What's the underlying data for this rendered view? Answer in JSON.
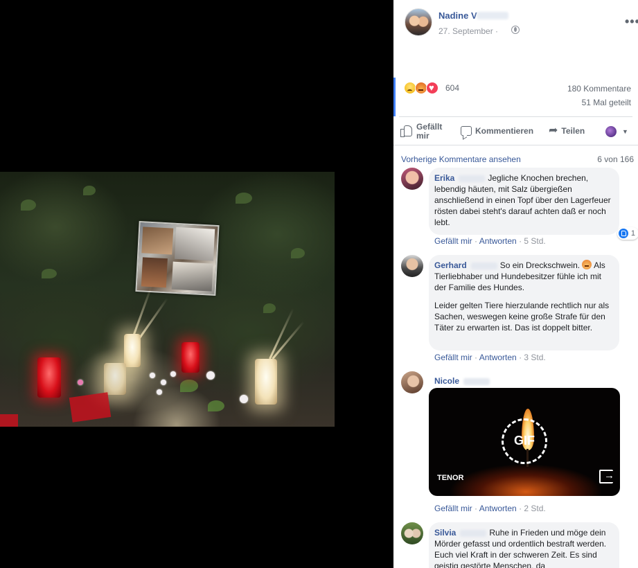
{
  "post": {
    "author": "Nadine V",
    "date": "27. September ·",
    "reaction_count": "604",
    "comments_count": "180 Kommentare",
    "shares_count": "51 Mal geteilt",
    "actions": {
      "like": "Gefällt mir",
      "comment": "Kommentieren",
      "share": "Teilen"
    },
    "icons": [
      "sad-reaction",
      "angry-reaction",
      "love-reaction",
      "globe-icon",
      "more-icon"
    ]
  },
  "comments_header": {
    "prev": "Vorherige Kommentare ansehen",
    "count": "6 von 166"
  },
  "meta_labels": {
    "like": "Gefällt mir",
    "reply": "Antworten",
    "sep": " · "
  },
  "comments": [
    {
      "name": "Erika",
      "text": "Jegliche Knochen brechen, lebendig häuten, mit Salz übergießen anschließend in einen Topf über den Lagerfeuer rösten dabei steht's darauf achten daß er noch lebt.",
      "time": "5 Std.",
      "likes": "1"
    },
    {
      "name": "Gerhard",
      "text": "So ein Dreckschwein.",
      "text2": "Als Tierliebhaber und Hundebesitzer fühle ich mit der Familie des Hundes.",
      "text3": "Leider gelten Tiere hierzulande rechtlich nur als Sachen, weswegen keine große Strafe für den Täter zu erwarten ist. Das ist doppelt bitter.",
      "time": "3 Std."
    },
    {
      "name": "Nicole",
      "gif_label": "GIF",
      "gif_provider": "TENOR",
      "time": "2 Std."
    },
    {
      "name": "Silvia",
      "text": "Ruhe in Frieden und möge dein Mörder gefasst und ordentlich bestraft werden. Euch viel Kraft in der schweren Zeit. Es sind geistig gestörte Menschen, da"
    }
  ],
  "colors": {
    "link": "#385898",
    "muted": "#606770",
    "bubble": "#f2f3f5",
    "accent": "#4080ff"
  }
}
